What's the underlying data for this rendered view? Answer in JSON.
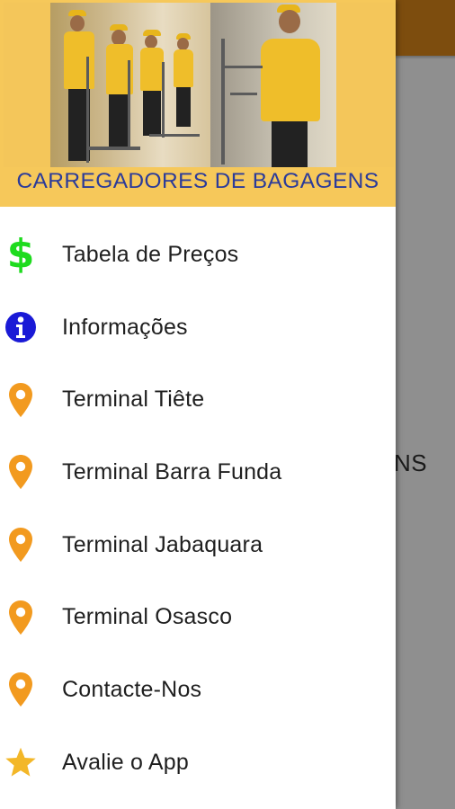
{
  "background": {
    "toolbar_color": "#7d4d0e",
    "partial_text": "NS"
  },
  "drawer": {
    "header": {
      "title": "CARREGADORES DE BAGAGENS",
      "title_color": "#2b3b9a",
      "background_color": "#f6c85a"
    },
    "menu": [
      {
        "label": "Tabela de Preços",
        "icon": "dollar-icon",
        "icon_color": "#1edb1e"
      },
      {
        "label": "Informações",
        "icon": "info-icon",
        "icon_color": "#1a1ad6"
      },
      {
        "label": "Terminal Tiête",
        "icon": "map-pin-icon",
        "icon_color": "#f29a1f"
      },
      {
        "label": "Terminal Barra Funda",
        "icon": "map-pin-icon",
        "icon_color": "#f29a1f"
      },
      {
        "label": "Terminal Jabaquara",
        "icon": "map-pin-icon",
        "icon_color": "#f29a1f"
      },
      {
        "label": "Terminal Osasco",
        "icon": "map-pin-icon",
        "icon_color": "#f29a1f"
      },
      {
        "label": "Contacte-Nos",
        "icon": "map-pin-icon",
        "icon_color": "#f29a1f"
      },
      {
        "label": "Avalie o App",
        "icon": "star-icon",
        "icon_color": "#f3b728"
      }
    ]
  }
}
